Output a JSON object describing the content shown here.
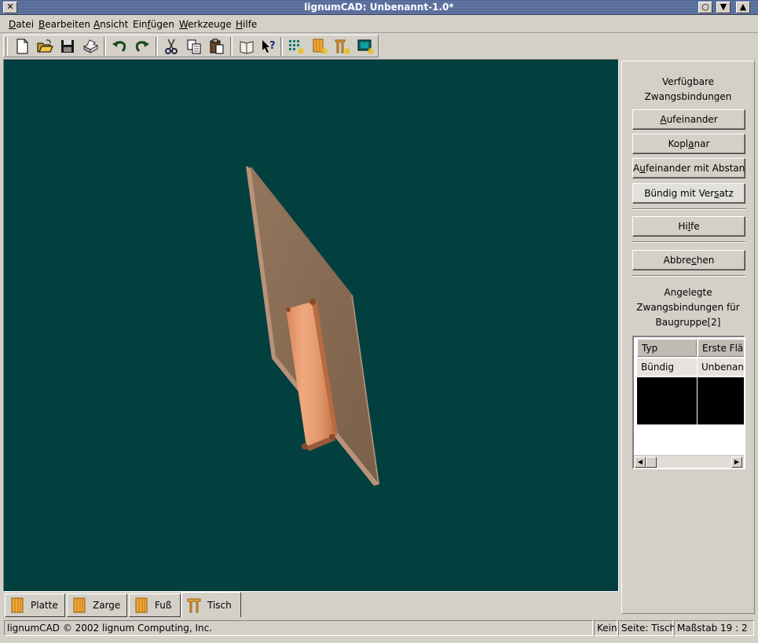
{
  "window": {
    "title": "lignumCAD: Unbenannt-1.0*",
    "close_glyph": "✕",
    "control_glyphs": [
      "○",
      "▼",
      "▲"
    ]
  },
  "menu": [
    {
      "label": "Datei"
    },
    {
      "label": "Bearbeiten"
    },
    {
      "label": "Ansicht"
    },
    {
      "label": "Einfügen"
    },
    {
      "label": "Werkzeuge"
    },
    {
      "label": "Hilfe"
    }
  ],
  "toolbar": {
    "icons": [
      "new-file",
      "open-folder",
      "save-floppy",
      "print",
      "undo",
      "redo",
      "cut",
      "copy",
      "paste",
      "help-book",
      "whats-this",
      "new-model",
      "new-board",
      "new-assembly",
      "new-view"
    ]
  },
  "viewport": {
    "background": "#023f3f",
    "board_color": "#8a6a52",
    "part_color": "#e0956a"
  },
  "tabs": [
    {
      "label": "Platte",
      "active": false
    },
    {
      "label": "Zarge",
      "active": false
    },
    {
      "label": "Fuß",
      "active": false
    },
    {
      "label": "Tisch",
      "active": true
    }
  ],
  "constraints_panel": {
    "available_heading_line1": "Verfügbare",
    "available_heading_line2": "Zwangsbindungen",
    "buttons": [
      {
        "label": "Aufeinander"
      },
      {
        "label": "Koplanar"
      },
      {
        "label": "Aufeinander mit Abstand"
      },
      {
        "label": "Bündig mit Versatz"
      }
    ],
    "help_label": "Hilfe",
    "cancel_label": "Abbrechen",
    "applied_heading_line1": "Angelegte",
    "applied_heading_line2": "Zwangsbindungen für",
    "applied_heading_line3": "Baugruppe[2]",
    "table": {
      "columns": [
        "Typ",
        "Erste Fläche"
      ],
      "rows": [
        [
          "Bündig",
          "Unbenannt"
        ]
      ]
    }
  },
  "status": {
    "copyright": "lignumCAD © 2002 lignum Computing, Inc.",
    "selection": "Kein",
    "page": "Seite: Tisch",
    "scale": "Maßstab 19 : 2"
  }
}
